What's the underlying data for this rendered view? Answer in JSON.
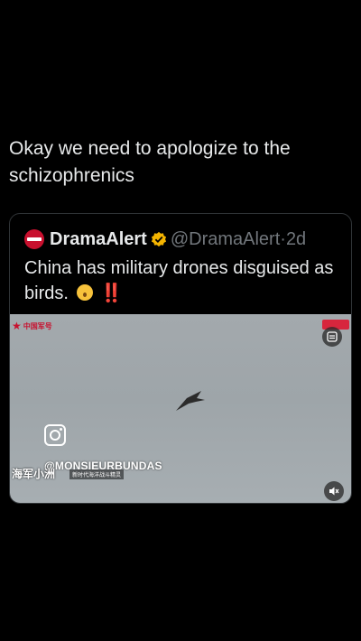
{
  "tweet": {
    "text": "Okay we need to apologize to the schizophrenics"
  },
  "quote": {
    "name": "DramaAlert",
    "handle": "@DramaAlert",
    "separator": "·",
    "time": "2d",
    "body": "China has military drones disguised as birds.",
    "bangs": "‼️"
  },
  "video": {
    "channel_label": "中国军号",
    "watermark_user": "@MONSIEURBUNDAS",
    "watermark_cn": "海军小洲",
    "watermark_sub": "新时代海洋战斗精灵",
    "icons": [
      "captions-icon",
      "sound-off-icon",
      "instagram-icon",
      "bird-drone"
    ]
  },
  "colors": {
    "background": "#000000",
    "text": "#e7e9ea",
    "muted": "#71767b",
    "border": "#2f3336",
    "verified": "#f4b400"
  }
}
